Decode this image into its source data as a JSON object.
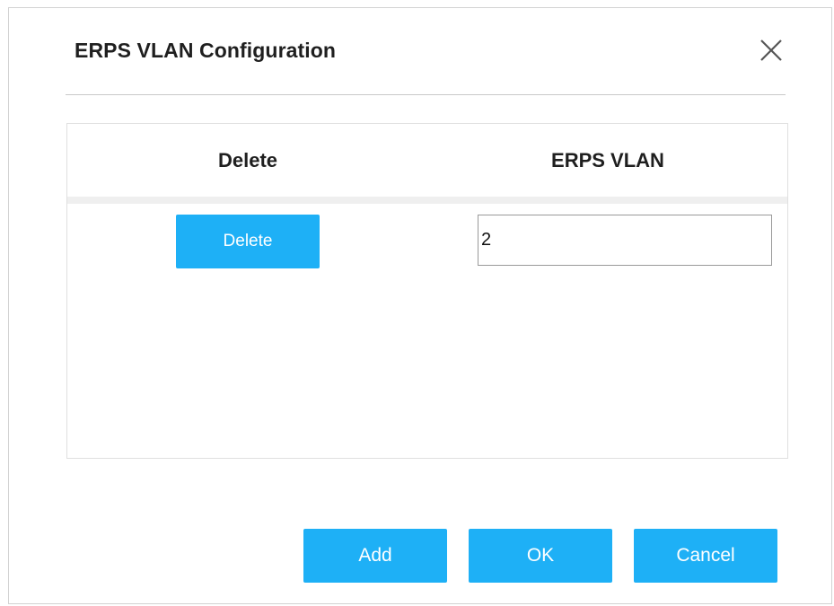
{
  "dialog": {
    "title": "ERPS VLAN Configuration",
    "close_icon": "close-icon"
  },
  "table": {
    "columns": [
      "Delete",
      "ERPS VLAN"
    ],
    "rows": [
      {
        "delete_label": "Delete",
        "vlan_value": "2"
      }
    ]
  },
  "footer": {
    "add_label": "Add",
    "ok_label": "OK",
    "cancel_label": "Cancel"
  },
  "colors": {
    "accent": "#1eb0f6",
    "text": "#1f1f1f",
    "divider": "#c9c9c9"
  }
}
